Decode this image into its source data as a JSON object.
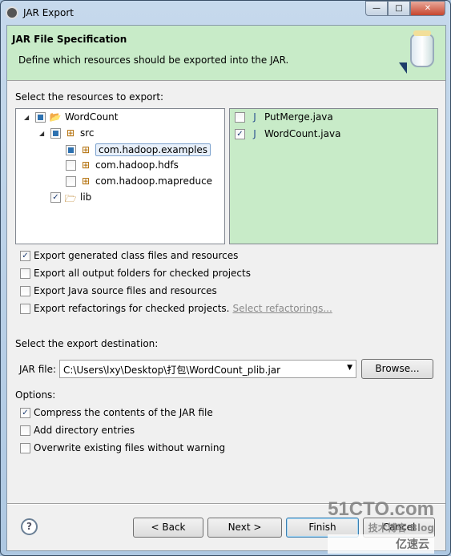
{
  "window": {
    "title": "JAR Export"
  },
  "header": {
    "title": "JAR File Specification",
    "description": "Define which resources should be exported into the JAR."
  },
  "resources": {
    "label": "Select the resources to export:",
    "tree": [
      {
        "label": "WordCount",
        "state": "partial",
        "expanded": true,
        "icon": "java-project-icon"
      },
      {
        "label": "src",
        "state": "partial",
        "expanded": true,
        "icon": "source-folder-icon"
      },
      {
        "label": "com.hadoop.examples",
        "state": "partial",
        "selected": true,
        "icon": "package-icon"
      },
      {
        "label": "com.hadoop.hdfs",
        "state": "unchecked",
        "icon": "package-icon"
      },
      {
        "label": "com.hadoop.mapreduce",
        "state": "unchecked",
        "icon": "package-icon"
      },
      {
        "label": "lib",
        "state": "checked",
        "icon": "folder-icon"
      }
    ],
    "files": [
      {
        "label": "PutMerge.java",
        "checked": false,
        "icon": "java-file-icon"
      },
      {
        "label": "WordCount.java",
        "checked": true,
        "icon": "java-file-icon"
      }
    ]
  },
  "export_options": [
    {
      "label": "Export generated class files and resources",
      "checked": true
    },
    {
      "label": "Export all output folders for checked projects",
      "checked": false
    },
    {
      "label": "Export Java source files and resources",
      "checked": false
    },
    {
      "label": "Export refactorings for checked projects.",
      "checked": false
    }
  ],
  "select_refactorings": "Select refactorings...",
  "destination": {
    "label": "Select the export destination:",
    "jar_label": "JAR file:",
    "jar_value": "C:\\Users\\lxy\\Desktop\\打包\\WordCount_plib.jar",
    "browse": "Browse..."
  },
  "options": {
    "label": "Options:",
    "items": [
      {
        "label": "Compress the contents of the JAR file",
        "checked": true
      },
      {
        "label": "Add directory entries",
        "checked": false
      },
      {
        "label": "Overwrite existing files without warning",
        "checked": false
      }
    ]
  },
  "buttons": {
    "back": "< Back",
    "next": "Next >",
    "finish": "Finish",
    "cancel": "Cancel"
  },
  "watermark": {
    "line1": "51CTO.com",
    "line2": "技术博客 Blog",
    "line3": "亿速云"
  },
  "colors": {
    "header_bg": "#c8ebc8",
    "files_bg": "#c8ebc8"
  }
}
